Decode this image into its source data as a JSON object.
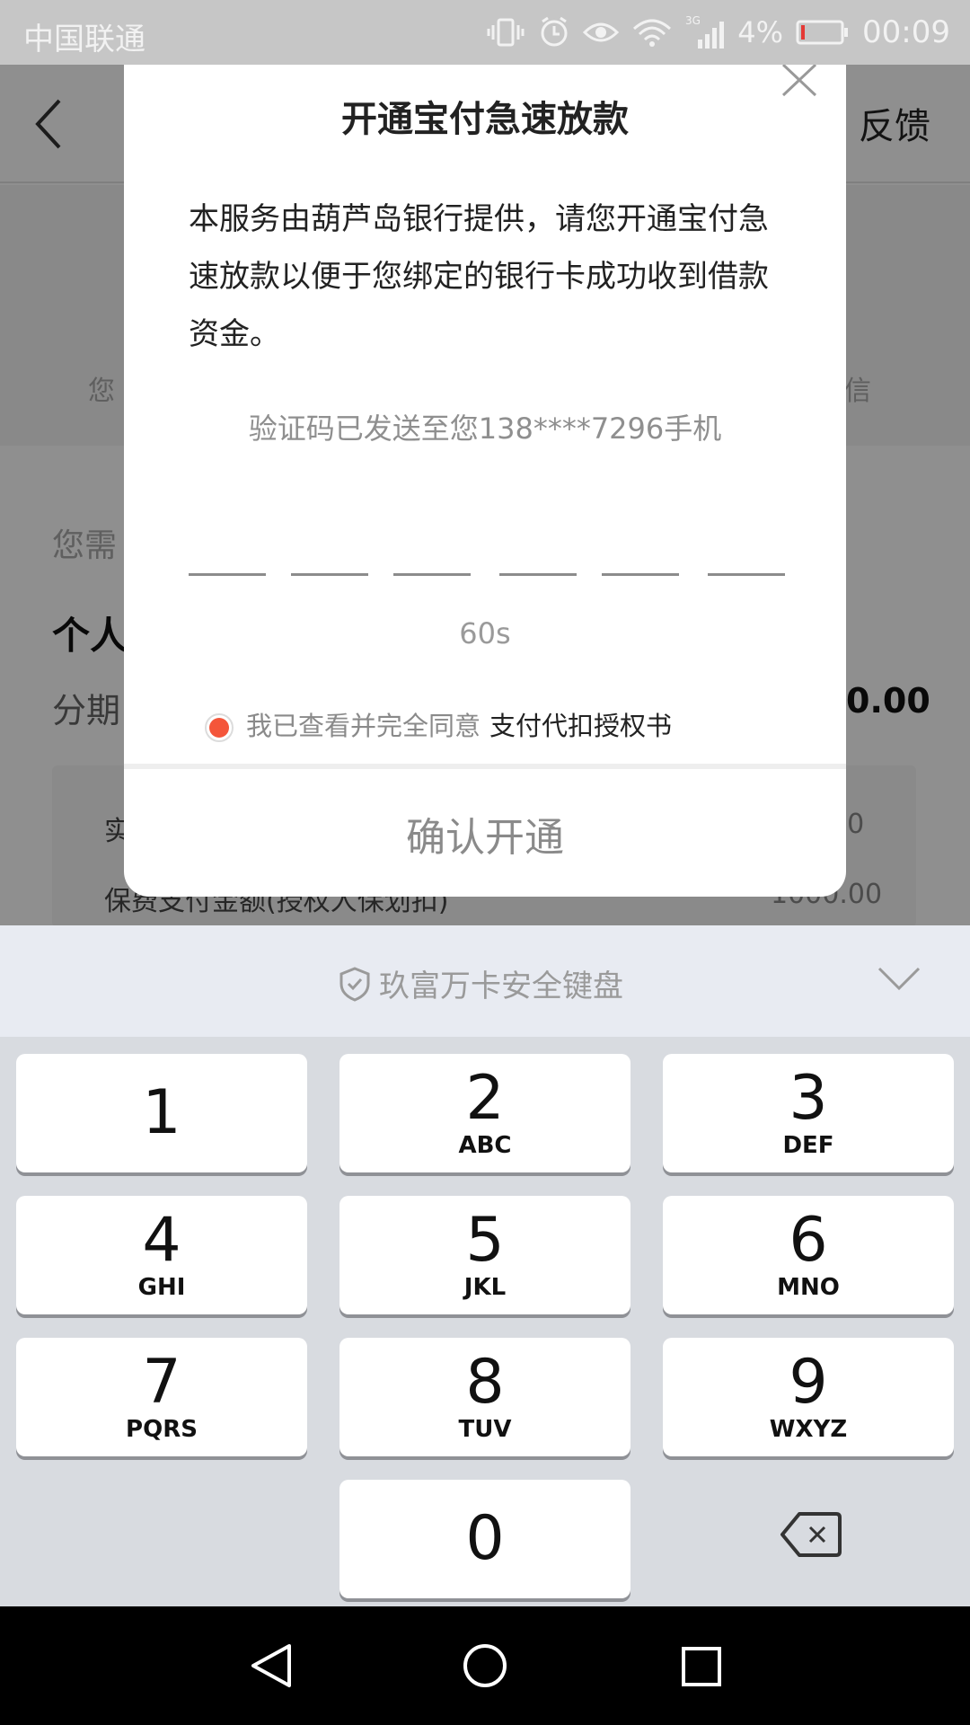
{
  "status_bar": {
    "carrier": "中国联通",
    "network": "3G",
    "battery": "4%",
    "time": "00:09"
  },
  "header": {
    "feedback": "反馈"
  },
  "background": {
    "hint_left": "您",
    "hint_right": "信",
    "need_text": "您需",
    "personal": "个人",
    "installment": "分期",
    "amount": "0.00",
    "row1_label": "实",
    "row1_value": "00",
    "row2_label": "保费支付金额(授权人保划扣)",
    "row2_value": "1000.00"
  },
  "dialog": {
    "title": "开通宝付急速放款",
    "description": "本服务由葫芦岛银行提供，请您开通宝付急速放款以便于您绑定的银行卡成功收到借款资金。",
    "code_sent": "验证码已发送至您138****7296手机",
    "countdown": "60s",
    "agree_text": "我已查看并完全同意",
    "agree_link": "支付代扣授权书",
    "confirm": "确认开通"
  },
  "keyboard": {
    "title": "玖富万卡安全键盘",
    "keys": [
      {
        "digit": "1",
        "letters": ""
      },
      {
        "digit": "2",
        "letters": "ABC"
      },
      {
        "digit": "3",
        "letters": "DEF"
      },
      {
        "digit": "4",
        "letters": "GHI"
      },
      {
        "digit": "5",
        "letters": "JKL"
      },
      {
        "digit": "6",
        "letters": "MNO"
      },
      {
        "digit": "7",
        "letters": "PQRS"
      },
      {
        "digit": "8",
        "letters": "TUV"
      },
      {
        "digit": "9",
        "letters": "WXYZ"
      },
      {
        "digit": "0",
        "letters": ""
      }
    ]
  },
  "colors": {
    "accent_radio": "#f4553a",
    "keyboard_header": "#e8ebf2",
    "keypad_bg": "#d8dbe0"
  }
}
